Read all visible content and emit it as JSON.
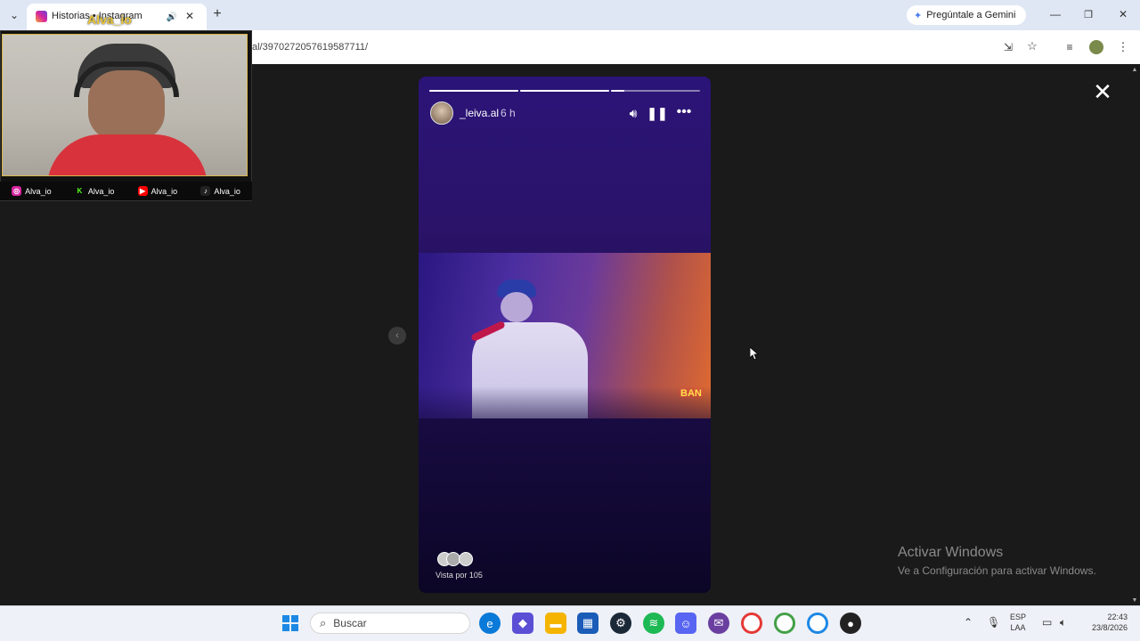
{
  "browser": {
    "tab_title": "Historias • Instagram",
    "url": "al/3970272057619587711/",
    "gemini_label": "Pregúntale a Gemini"
  },
  "webcam": {
    "watermark": "Alva_io",
    "socials": [
      {
        "icon": "instagram-icon",
        "label": "Alva_io",
        "color": "#d6249f"
      },
      {
        "icon": "kick-icon",
        "label": "Alva_io",
        "color": "#53fc18"
      },
      {
        "icon": "youtube-icon",
        "label": "Alva_io",
        "color": "#ff0000"
      },
      {
        "icon": "tiktok-icon",
        "label": "Alva_io",
        "color": "#000000"
      }
    ]
  },
  "story": {
    "username": "_leiva.al",
    "time": "6 h",
    "progress": [
      1.0,
      1.0,
      0.15
    ],
    "viewers_label": "Vista por 105",
    "media_badge": "BAN"
  },
  "windows": {
    "activation_title": "Activar Windows",
    "activation_sub": "Ve a Configuración para activar Windows."
  },
  "taskbar": {
    "search_placeholder": "Buscar",
    "lang_top": "ESP",
    "lang_bottom": "LAA",
    "time": "22:43",
    "date": "23/8/2026"
  }
}
